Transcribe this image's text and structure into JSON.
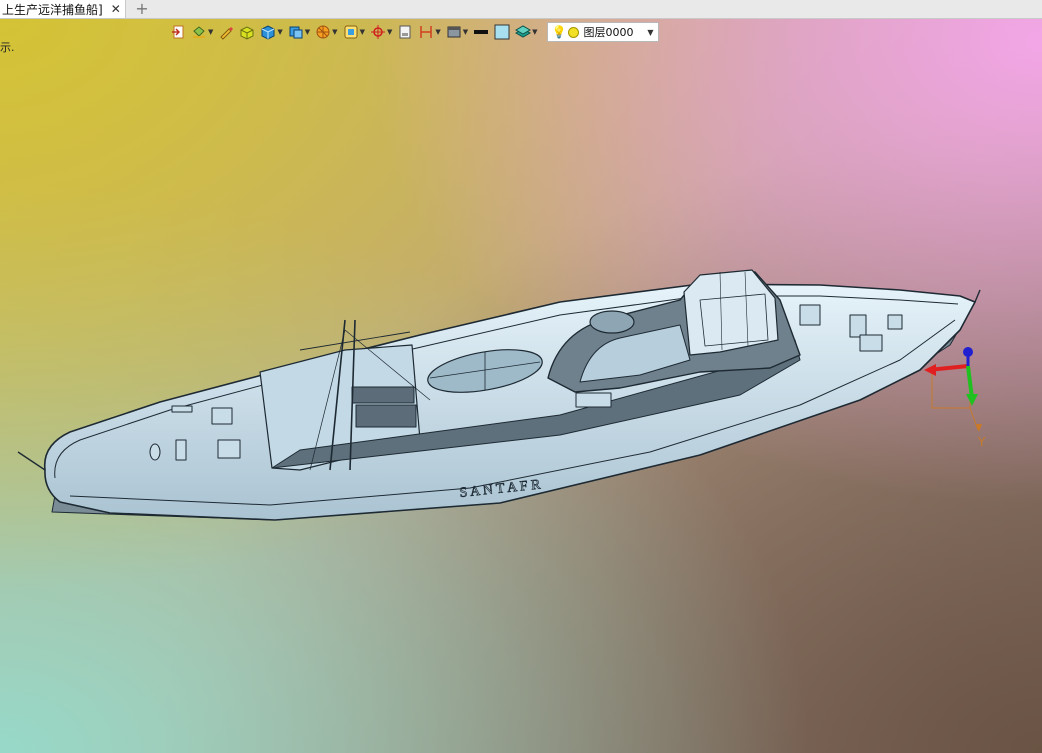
{
  "tab": {
    "title": "上生产远洋捕鱼船]",
    "close_glyph": "✕",
    "add_glyph": "+"
  },
  "status_text": "示.",
  "toolbar": {
    "tools": [
      {
        "name": "exit-sketch-icon",
        "has_dropdown": false
      },
      {
        "name": "paint-bucket-icon",
        "has_dropdown": true
      },
      {
        "name": "pencil-icon",
        "has_dropdown": false
      },
      {
        "name": "shaded-box-icon",
        "has_dropdown": false
      },
      {
        "name": "solid-cube-icon",
        "has_dropdown": true
      },
      {
        "name": "view-cube-icon",
        "has_dropdown": true
      },
      {
        "name": "render-sphere-icon",
        "has_dropdown": true
      },
      {
        "name": "frame-view-icon",
        "has_dropdown": true
      },
      {
        "name": "snap-target-icon",
        "has_dropdown": true
      },
      {
        "name": "page-icon",
        "has_dropdown": false
      },
      {
        "name": "dimension-icon",
        "has_dropdown": true
      },
      {
        "name": "display-mode-icon",
        "has_dropdown": true
      },
      {
        "name": "line-color-icon",
        "has_dropdown": false
      },
      {
        "name": "fill-color-icon",
        "has_dropdown": false
      },
      {
        "name": "layers-icon",
        "has_dropdown": true
      }
    ],
    "layer_select": {
      "value": "图层0000",
      "dot_color": "#f2e024"
    }
  },
  "viewport": {
    "model": "fishing-vessel-3d-model",
    "hull_color": "#d2e6f0",
    "edge_color": "#1e2a33",
    "axes": {
      "x_color": "#e02020",
      "y_color": "#20c020",
      "z_color": "#2020d0",
      "y_label": "Y"
    }
  }
}
